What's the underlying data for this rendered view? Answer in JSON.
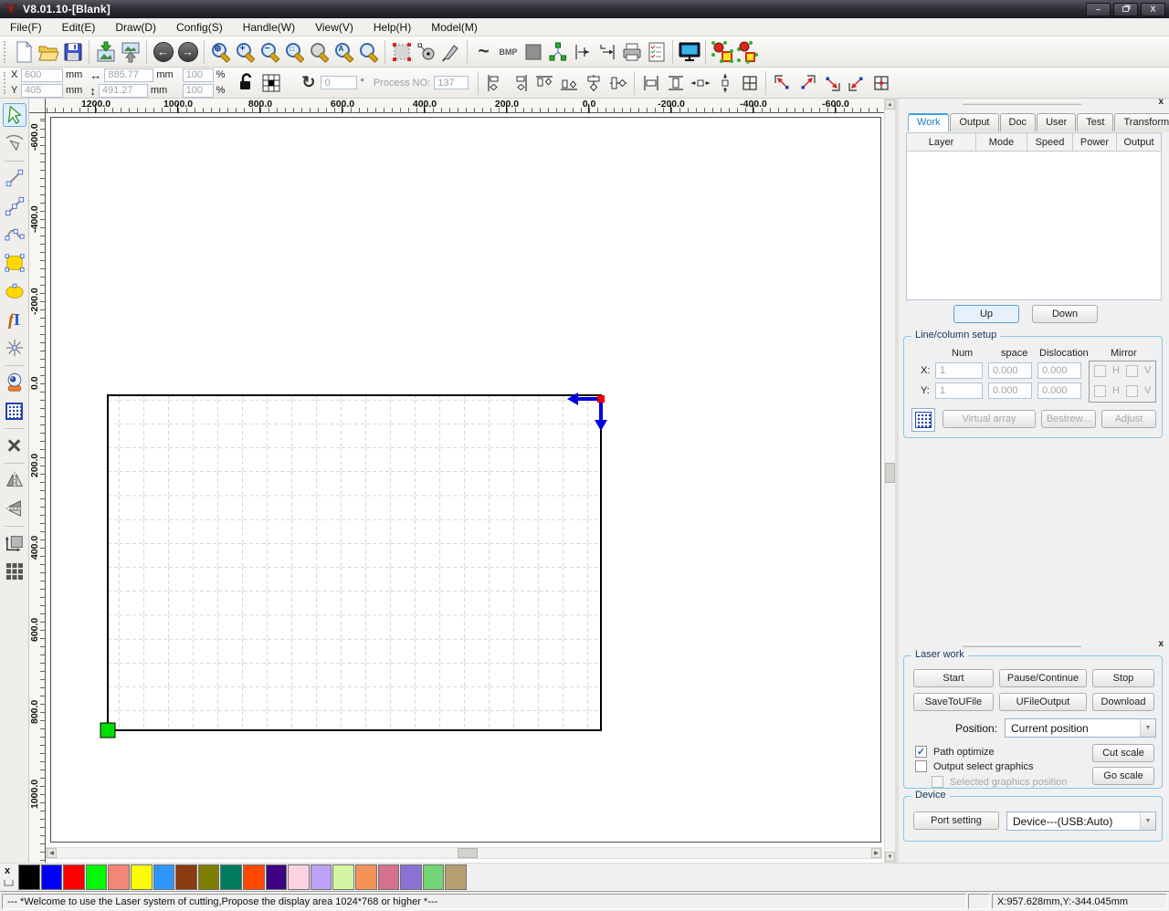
{
  "window": {
    "title": "V8.01.10-[Blank]"
  },
  "menu": {
    "items": [
      {
        "label": "File(F)"
      },
      {
        "label": "Edit(E)"
      },
      {
        "label": "Draw(D)"
      },
      {
        "label": "Config(S)"
      },
      {
        "label": "Handle(W)"
      },
      {
        "label": "View(V)"
      },
      {
        "label": "Help(H)"
      },
      {
        "label": "Model(M)"
      }
    ]
  },
  "props": {
    "x_label": "X",
    "x_value": "600",
    "y_label": "Y",
    "y_value": "405",
    "unit_mm": "mm",
    "width_value": "885.77",
    "height_value": "491.27",
    "scale_x": "100",
    "scale_y": "100",
    "percent": "%",
    "rotate_value": "0",
    "degree": "°",
    "process_label": "Process NO:",
    "process_value": "137"
  },
  "icons": {
    "min": "–",
    "close": "X",
    "undo": "←",
    "redo": "→",
    "zoom_pan": "⊕",
    "zoom_in": "+",
    "zoom_out": "−",
    "zoom_page": "□",
    "zoom_all": "A",
    "curve": "~",
    "bmp": "BMP",
    "rotate": "↻",
    "h_arrow": "↔",
    "v_arrow": "↕",
    "delete": "×",
    "text_f": "f",
    "text_i": "I",
    "check": "✓",
    "dd": "▼",
    "scroll_up": "▲",
    "scroll_down": "▼",
    "scroll_left": "◀",
    "scroll_right": "▶",
    "panel_close": "x",
    "palette_x": "x"
  },
  "rulers": {
    "top": [
      "1200.0",
      "1000.0",
      "800.0",
      "600.0",
      "400.0",
      "200.0",
      "0.0",
      "-200.0",
      "-400.0",
      "-600.0"
    ],
    "left": [
      "-600.0",
      "-400.0",
      "-200.0",
      "0.0",
      "200.0",
      "400.0",
      "600.0",
      "800.0",
      "1000.0"
    ]
  },
  "panel": {
    "tabs": [
      {
        "label": "Work",
        "active": true
      },
      {
        "label": "Output"
      },
      {
        "label": "Doc"
      },
      {
        "label": "User"
      },
      {
        "label": "Test"
      },
      {
        "label": "Transform"
      }
    ],
    "headers": [
      "Layer",
      "Mode",
      "Speed",
      "Power",
      "Output"
    ],
    "up": "Up",
    "down": "Down"
  },
  "line_column": {
    "title": "Line/column setup",
    "col_num": "Num",
    "col_space": "space",
    "col_dislocation": "Dislocation",
    "col_mirror": "Mirror",
    "x_label": "X:",
    "y_label": "Y:",
    "x_num": "1",
    "x_space": "0.000",
    "x_disl": "0.000",
    "y_num": "1",
    "y_space": "0.000",
    "y_disl": "0.000",
    "h": "H",
    "v": "V",
    "btn_virtual": "Virtual array",
    "btn_bestrew": "Bestrew...",
    "btn_adjust": "Adjust"
  },
  "laser": {
    "title": "Laser work",
    "start": "Start",
    "pause": "Pause/Continue",
    "stop": "Stop",
    "save_ufile": "SaveToUFile",
    "ufile_output": "UFileOutput",
    "download": "Download",
    "position_label": "Position:",
    "position_value": "Current position",
    "cb_path": "Path optimize",
    "cb_output": "Output select graphics",
    "cb_selected": "Selected graphics position",
    "cut_scale": "Cut scale",
    "go_scale": "Go scale"
  },
  "device": {
    "title": "Device",
    "port": "Port setting",
    "value": "Device---(USB:Auto)"
  },
  "palette": {
    "colors": [
      "#000000",
      "#0000F8",
      "#FC0000",
      "#00F800",
      "#F38677",
      "#FCFC00",
      "#3096FC",
      "#8C3A10",
      "#7E7E00",
      "#007C5E",
      "#FC4800",
      "#3F0082",
      "#FCD2E0",
      "#BCA2F6",
      "#D4F6A2",
      "#F69158",
      "#D4718F",
      "#8972D4",
      "#72D472",
      "#B89F72"
    ]
  },
  "status": {
    "message": "--- *Welcome to use the Laser system of cutting,Propose the display area 1024*768 or higher *---",
    "coords": "X:957.628mm,Y:-344.045mm"
  }
}
